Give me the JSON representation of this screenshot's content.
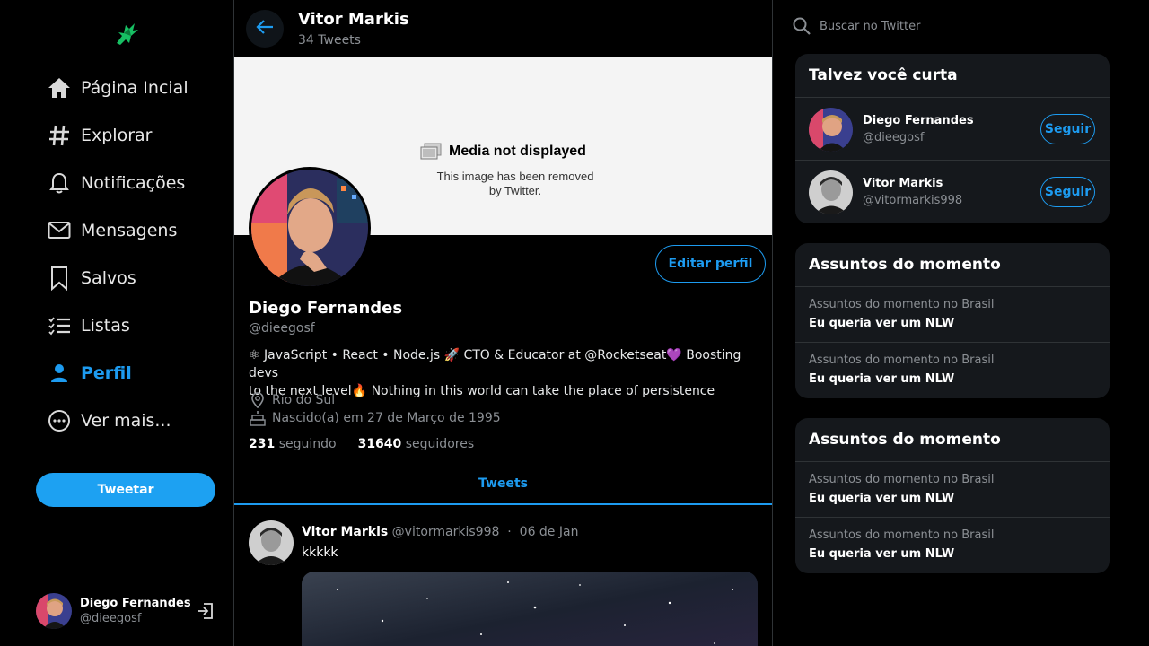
{
  "sidebar": {
    "items": [
      {
        "label": "Página Incial",
        "icon": "home-icon"
      },
      {
        "label": "Explorar",
        "icon": "hashtag-icon"
      },
      {
        "label": "Notificações",
        "icon": "bell-icon"
      },
      {
        "label": "Mensagens",
        "icon": "mail-icon"
      },
      {
        "label": "Salvos",
        "icon": "bookmark-icon"
      },
      {
        "label": "Listas",
        "icon": "list-icon"
      },
      {
        "label": "Perfil",
        "icon": "person-icon",
        "active": true
      },
      {
        "label": "Ver mais...",
        "icon": "more-icon"
      }
    ],
    "tweet_button": "Tweetar",
    "user": {
      "name": "Diego Fernandes",
      "handle": "@dieegosf"
    }
  },
  "header": {
    "title": "Vitor Markis",
    "subtitle": "34 Tweets"
  },
  "banner": {
    "title": "Media not displayed",
    "line1": "This image has been removed",
    "line2": "by Twitter."
  },
  "profile": {
    "edit_button": "Editar perfil",
    "name": "Diego Fernandes",
    "handle": "@dieegosf",
    "bio_line1": "⚛ JavaScript • React • Node.js 🚀 CTO & Educator at @Rocketseat💜 Boosting devs",
    "bio_line2": "to the next level🔥 Nothing in this world can take the place of persistence",
    "location": "Rio do Sul",
    "birthday": "Nascido(a) em 27 de Março de 1995",
    "following_count": "231",
    "following_label": "seguindo",
    "followers_count": "31640",
    "followers_label": "seguidores"
  },
  "tabs": {
    "tweets": "Tweets"
  },
  "tweet": {
    "name": "Vitor Markis",
    "handle": "@vitormarkis998",
    "separator": "·",
    "date": "06 de Jan",
    "text": "kkkkk"
  },
  "search": {
    "placeholder": "Buscar no Twitter"
  },
  "who_to_follow": {
    "title": "Talvez você curta",
    "users": [
      {
        "name": "Diego Fernandes",
        "handle": "@dieegosf",
        "button": "Seguir"
      },
      {
        "name": "Vitor Markis",
        "handle": "@vitormarkis998",
        "button": "Seguir"
      }
    ]
  },
  "trends": [
    {
      "title": "Assuntos do momento",
      "items": [
        {
          "context": "Assuntos do momento no Brasil",
          "topic": "Eu queria ver um NLW"
        },
        {
          "context": "Assuntos do momento no Brasil",
          "topic": "Eu queria ver um NLW"
        }
      ]
    },
    {
      "title": "Assuntos do momento",
      "items": [
        {
          "context": "Assuntos do momento no Brasil",
          "topic": "Eu queria ver um NLW"
        },
        {
          "context": "Assuntos do momento no Brasil",
          "topic": "Eu queria ver um NLW"
        }
      ]
    }
  ],
  "colors": {
    "accent": "#1d9bf0",
    "button": "#1da1f2",
    "card": "#15181c",
    "logo": "#17bf63",
    "muted": "#8b8f94"
  }
}
